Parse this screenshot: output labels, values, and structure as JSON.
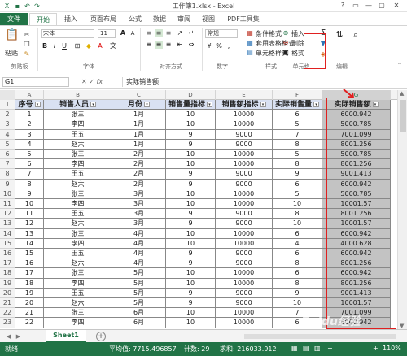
{
  "window": {
    "title": "工作簿1.xlsx - Excel",
    "controls": [
      "?",
      "▭",
      "—",
      "▢",
      "✕"
    ]
  },
  "tabs": [
    "文件",
    "开始",
    "插入",
    "页面布局",
    "公式",
    "数据",
    "审阅",
    "视图",
    "PDF工具集"
  ],
  "active_tab": "开始",
  "ribbon": {
    "clipboard": {
      "paste": "粘贴",
      "group": "剪贴板"
    },
    "font": {
      "name": "宋体",
      "size": "11",
      "group": "字体"
    },
    "alignment": {
      "group": "对齐方式"
    },
    "number": {
      "format": "常规",
      "group": "数字"
    },
    "styles": {
      "conditional": "条件格式",
      "table": "套用表格格式",
      "cell": "单元格样式",
      "group": "样式"
    },
    "cells": {
      "insert": "插入",
      "delete": "删除",
      "format": "格式",
      "group": "单元格"
    },
    "editing": {
      "group": "编辑"
    }
  },
  "formula_bar": {
    "name_box": "G1",
    "fx": "fx",
    "value": "实际销售额"
  },
  "sheet": {
    "columns": [
      "A",
      "B",
      "C",
      "D",
      "E",
      "F",
      "G"
    ],
    "header": [
      "序号",
      "销售人员",
      "月份",
      "销售量指标",
      "销售额指标",
      "实际销售量",
      "实际销售额"
    ],
    "rows": [
      [
        "1",
        "张三",
        "1月",
        "10",
        "10000",
        "6",
        "6000.942"
      ],
      [
        "2",
        "李四",
        "1月",
        "10",
        "10000",
        "5",
        "5000.785"
      ],
      [
        "3",
        "王五",
        "1月",
        "9",
        "9000",
        "7",
        "7001.099"
      ],
      [
        "4",
        "赵六",
        "1月",
        "9",
        "9000",
        "8",
        "8001.256"
      ],
      [
        "5",
        "张三",
        "2月",
        "10",
        "10000",
        "5",
        "5000.785"
      ],
      [
        "6",
        "李四",
        "2月",
        "10",
        "10000",
        "8",
        "8001.256"
      ],
      [
        "7",
        "王五",
        "2月",
        "9",
        "9000",
        "9",
        "9001.413"
      ],
      [
        "8",
        "赵六",
        "2月",
        "9",
        "9000",
        "6",
        "6000.942"
      ],
      [
        "9",
        "张三",
        "3月",
        "10",
        "10000",
        "5",
        "5000.785"
      ],
      [
        "10",
        "李四",
        "3月",
        "10",
        "10000",
        "10",
        "10001.57"
      ],
      [
        "11",
        "王五",
        "3月",
        "9",
        "9000",
        "8",
        "8001.256"
      ],
      [
        "12",
        "赵六",
        "3月",
        "9",
        "9000",
        "10",
        "10001.57"
      ],
      [
        "13",
        "张三",
        "4月",
        "10",
        "10000",
        "6",
        "6000.942"
      ],
      [
        "14",
        "李四",
        "4月",
        "10",
        "10000",
        "4",
        "4000.628"
      ],
      [
        "15",
        "王五",
        "4月",
        "9",
        "9000",
        "6",
        "6000.942"
      ],
      [
        "16",
        "赵六",
        "4月",
        "9",
        "9000",
        "8",
        "8001.256"
      ],
      [
        "17",
        "张三",
        "5月",
        "10",
        "10000",
        "6",
        "6000.942"
      ],
      [
        "18",
        "李四",
        "5月",
        "10",
        "10000",
        "8",
        "8001.256"
      ],
      [
        "19",
        "王五",
        "5月",
        "9",
        "9000",
        "9",
        "9001.413"
      ],
      [
        "20",
        "赵六",
        "5月",
        "9",
        "9000",
        "10",
        "10001.57"
      ],
      [
        "21",
        "张三",
        "6月",
        "10",
        "10000",
        "7",
        "7001.099"
      ],
      [
        "22",
        "李四",
        "6月",
        "10",
        "10000",
        "6",
        "6000.942"
      ]
    ],
    "row_numbers": [
      "1",
      "2",
      "3",
      "4",
      "5",
      "6",
      "7",
      "8",
      "9",
      "10",
      "11",
      "12",
      "13",
      "14",
      "15",
      "16",
      "17",
      "18",
      "19",
      "20",
      "21",
      "22",
      "23"
    ]
  },
  "sheet_tabs": {
    "active": "Sheet1",
    "add": "+"
  },
  "status": {
    "ready": "就绪",
    "average": "平均值: 7715.496857",
    "count": "计数: 29",
    "sum": "求和: 216033.912",
    "zoom": "110%"
  },
  "watermark": "Baidu经验",
  "colors": {
    "excel_green": "#217346",
    "header_fill": "#d9e1f2",
    "selection_gray": "#c3c3c3",
    "annotation_red": "#e02020"
  }
}
